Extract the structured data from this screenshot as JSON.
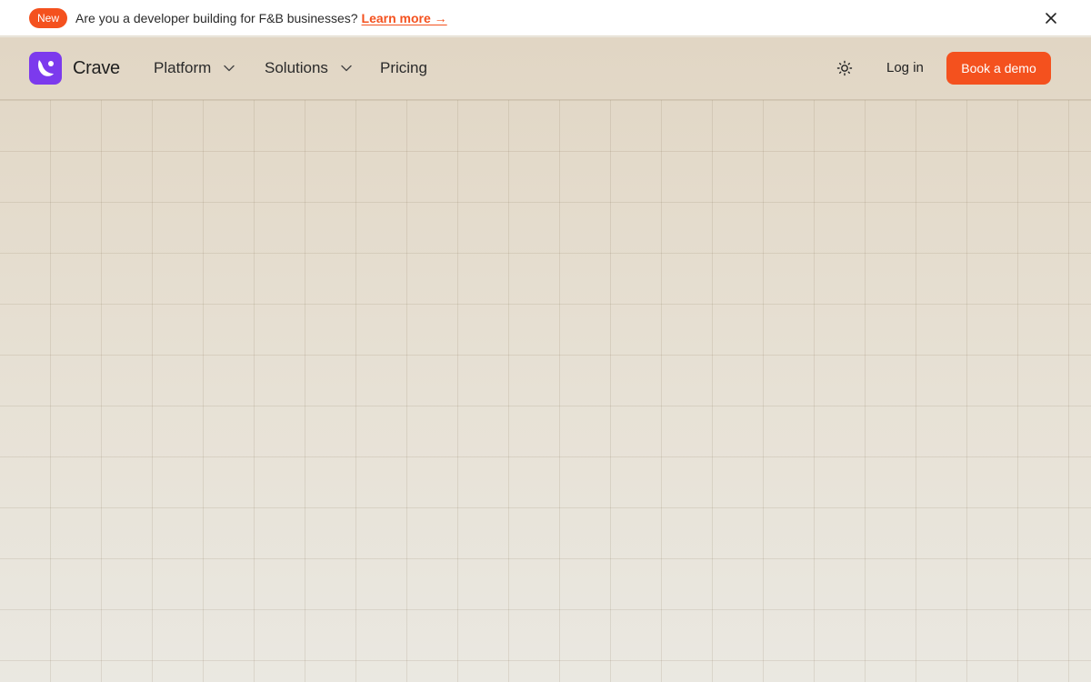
{
  "announcement": {
    "badge": "New",
    "text": "Are you a developer building for F&B businesses?",
    "link_label": "Learn more →",
    "close_icon": "close-icon"
  },
  "nav": {
    "brand": "Crave",
    "logo_icon": "crave-logo-icon",
    "items": [
      {
        "label": "Platform",
        "has_dropdown": true
      },
      {
        "label": "Solutions",
        "has_dropdown": true
      },
      {
        "label": "Pricing",
        "has_dropdown": false
      }
    ],
    "theme_icon": "sun-icon",
    "login_label": "Log in",
    "cta_label": "Book a demo"
  },
  "colors": {
    "accent": "#f4511e",
    "brand": "#7c3aed"
  }
}
